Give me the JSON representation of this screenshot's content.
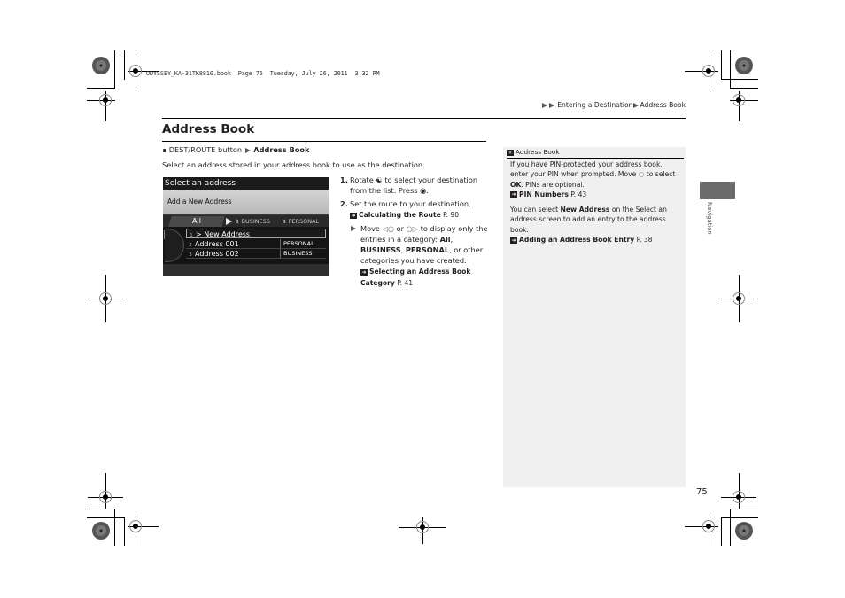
{
  "print_header": "ODYSSEY_KA-31TK8810.book  Page 75  Tuesday, July 26, 2011  3:32 PM",
  "breadcrumb": {
    "items": [
      "Entering a Destination",
      "Address Book"
    ]
  },
  "page": {
    "title": "Address Book",
    "route": {
      "icon": "voice-command-icon",
      "button": "DEST/ROUTE button",
      "target": "Address Book"
    },
    "intro": "Select an address stored in your address book to use as the destination."
  },
  "screen": {
    "title": "Select an address",
    "prompt": "Add a New Address",
    "tabs": {
      "active": "All",
      "other": [
        "BUSINESS",
        "PERSONAL"
      ]
    },
    "rows": [
      {
        "num": "1",
        "label": "> New Address",
        "category": ""
      },
      {
        "num": "2",
        "label": "Address 001",
        "category": "PERSONAL"
      },
      {
        "num": "3",
        "label": "Address 002",
        "category": "BUSINESS"
      }
    ]
  },
  "steps": [
    {
      "num": "1.",
      "text_a": "Rotate",
      "icon_a": "interface-dial-rotate-icon",
      "text_b": "to select your destination from the list. Press",
      "icon_b": "interface-dial-press-icon",
      "text_c": "."
    },
    {
      "num": "2.",
      "text": "Set the route to your destination.",
      "xref_title": "Calculating the Route",
      "xref_page": "P. 90"
    }
  ],
  "substep": {
    "text_a": "Move",
    "icon_a": "dial-left-icon",
    "text_or": "or",
    "icon_b": "dial-right-icon",
    "text_b": "to display only the entries in a category:",
    "cat_all": "All",
    "cat_business": "BUSINESS",
    "cat_personal": "PERSONAL",
    "text_c": ", or other categories you have created.",
    "xref_title": "Selecting an Address Book Category",
    "xref_page": "P. 41"
  },
  "sidebar": {
    "heading": "Address Book",
    "para1_a": "If you have PIN-protected your address book, enter your PIN when prompted. Move",
    "para1_icon": "dial-down-icon",
    "para1_b": "to select",
    "para1_ok": "OK",
    "para1_c": ". PINs are optional.",
    "xref1_title": "PIN Numbers",
    "xref1_page": "P. 43",
    "para2_a": "You can select",
    "para2_bold": "New Address",
    "para2_b": "on the Select an address screen to add an entry to the address book.",
    "xref2_title": "Adding an Address Book Entry",
    "xref2_page": "P. 38"
  },
  "side_tab": {
    "label": "Navigation"
  },
  "page_number": "75"
}
